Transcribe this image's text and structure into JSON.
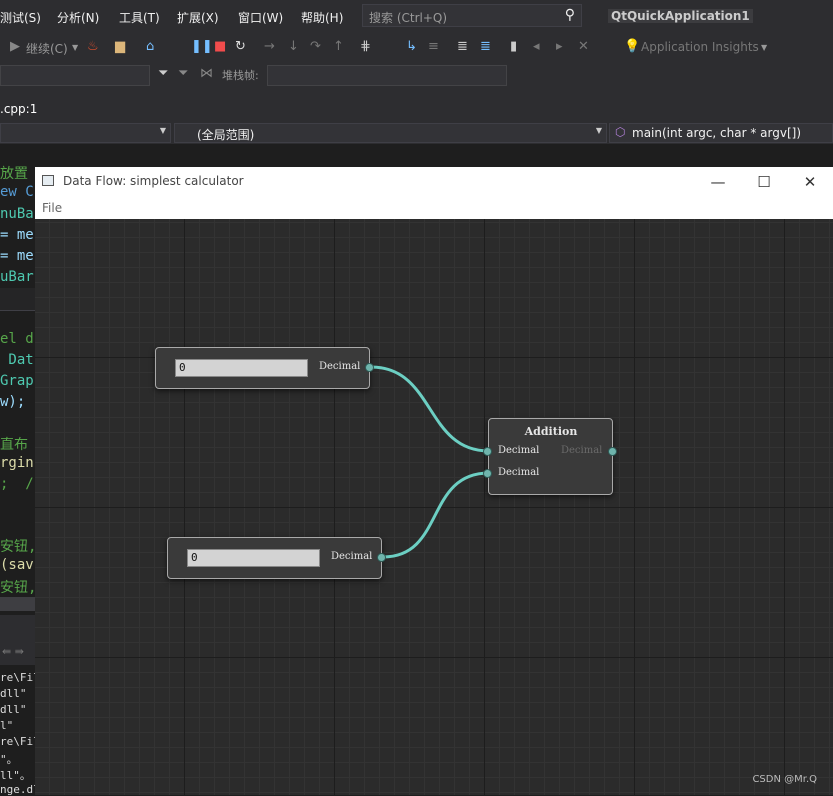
{
  "vs": {
    "menu": [
      "测试(S)",
      "分析(N)",
      "工具(T)",
      "扩展(X)",
      "窗口(W)",
      "帮助(H)"
    ],
    "search_placeholder": "搜索 (Ctrl+Q)",
    "project": "QtQuickApplication1",
    "continue_label": "继续(C)",
    "insights_label": "Application Insights",
    "stackframe_label": "堆栈帧:",
    "file_tab": ".cpp:1",
    "scope_combo": "(全局范围)",
    "function_combo": "main(int argc, char * argv[])"
  },
  "code_lines": [
    {
      "text": "放置",
      "color": "#57a64a"
    },
    {
      "text": "ew C",
      "color": "#569cd6"
    },
    {
      "text": "nuBa",
      "color": "#4ec9b0"
    },
    {
      "text": "= me",
      "color": "#9cdcfe"
    },
    {
      "text": "= me",
      "color": "#9cdcfe"
    },
    {
      "text": "uBar",
      "color": "#4ec9b0"
    },
    {
      "text": "el d",
      "color": "#57a64a"
    },
    {
      "text": " Dat",
      "color": "#4ec9b0"
    },
    {
      "text": "Grap",
      "color": "#4ec9b0"
    },
    {
      "text": "w);",
      "color": "#9cdcfe"
    },
    {
      "text": "直布",
      "color": "#57a64a"
    },
    {
      "text": "rgin",
      "color": "#dcdcaa"
    },
    {
      "text": ";  /",
      "color": "#57a64a"
    },
    {
      "text": "安钮,",
      "color": "#57a64a"
    },
    {
      "text": "(sav",
      "color": "#dcdcaa"
    },
    {
      "text": "安钮,",
      "color": "#57a64a"
    }
  ],
  "output_lines": [
    "re\\Fil",
    "dll\"",
    "dll\"",
    "l\"",
    "re\\Fil",
    "\"。",
    "ll\"。",
    "nge.dl"
  ],
  "app": {
    "title": "Data Flow: simplest calculator",
    "menu_file": "File",
    "minimize": "—",
    "maximize": "☐",
    "close": "✕",
    "nodes": {
      "input1": {
        "value": "0",
        "port_label": "Decimal"
      },
      "input2": {
        "value": "0",
        "port_label": "Decimal"
      },
      "addition": {
        "title": "Addition",
        "input_labels": [
          "Decimal",
          "Decimal"
        ],
        "output_label": "Decimal"
      }
    },
    "connection_color": "#6ccfc3",
    "port_color": "#6fb4ac"
  },
  "watermark": "CSDN @Mr.Q"
}
